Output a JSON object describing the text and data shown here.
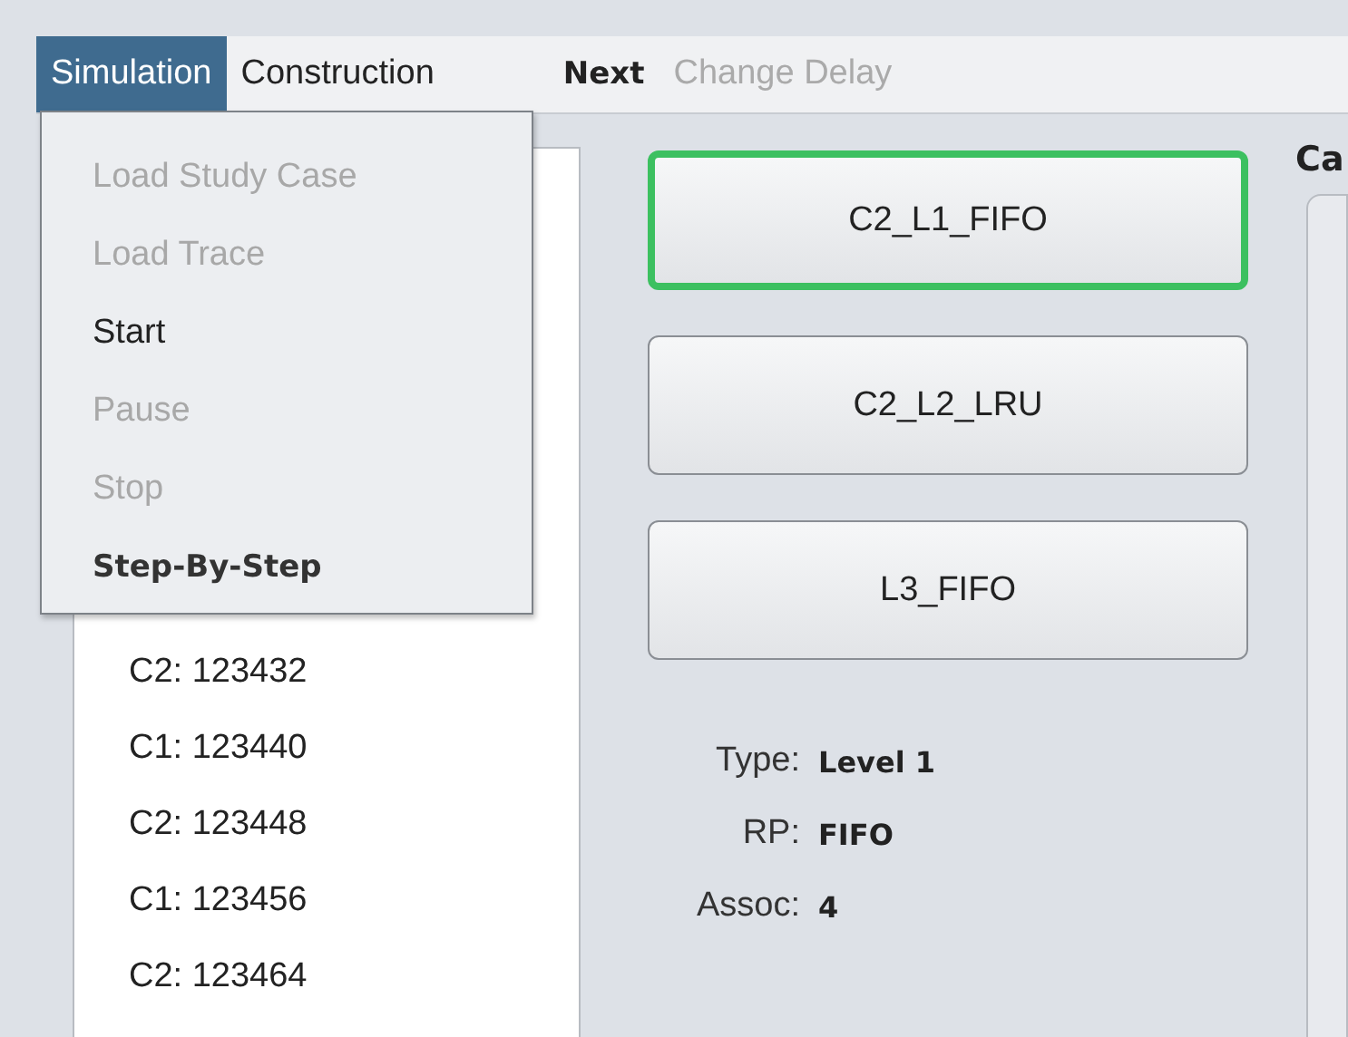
{
  "menubar": {
    "menus": [
      {
        "label": "Simulation",
        "selected": true
      },
      {
        "label": "Construction",
        "selected": false
      }
    ],
    "actions": [
      {
        "label": "Next",
        "disabled": false
      },
      {
        "label": "Change Delay",
        "disabled": true
      }
    ]
  },
  "dropdown": {
    "items": [
      {
        "label": "Load Study Case",
        "disabled": true,
        "default": false
      },
      {
        "label": "Load Trace",
        "disabled": true,
        "default": false
      },
      {
        "label": "Start",
        "disabled": false,
        "default": false
      },
      {
        "label": "Pause",
        "disabled": true,
        "default": false
      },
      {
        "label": "Stop",
        "disabled": true,
        "default": false
      },
      {
        "label": "Step-By-Step",
        "disabled": false,
        "default": true
      }
    ]
  },
  "trace_list": {
    "items": [
      "C2: 123432",
      "C1: 123440",
      "C2: 123448",
      "C1: 123456",
      "C2: 123464"
    ]
  },
  "caches": [
    {
      "label": "C2_L1_FIFO",
      "selected": true
    },
    {
      "label": "C2_L2_LRU",
      "selected": false
    },
    {
      "label": "L3_FIFO",
      "selected": false
    }
  ],
  "details": [
    {
      "label": "Type:",
      "value": "Level 1"
    },
    {
      "label": "RP:",
      "value": "FIFO"
    },
    {
      "label": "Assoc:",
      "value": "4"
    }
  ],
  "right_panel": {
    "title": "Ca"
  }
}
